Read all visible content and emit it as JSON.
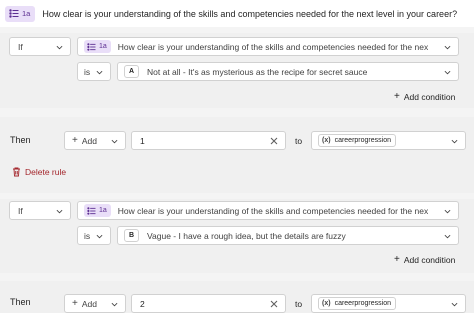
{
  "header": {
    "question_id": "1a",
    "question_icon": "choice-list-icon",
    "title": "How clear is your understanding of the skills and competencies needed for the next level in your career?"
  },
  "rules": [
    {
      "condition_type": "If",
      "question_id": "1a",
      "question_text": "How clear is your understanding of the skills and competencies needed for the next l...",
      "operator": "is",
      "answer_letter": "A",
      "answer_text": "Not at all - It's as mysterious as the recipe for secret sauce",
      "add_condition_label": "Add condition",
      "then_label": "Then",
      "action_label": "Add",
      "action_value": "1",
      "to_label": "to",
      "variable_icon": "(x)",
      "variable_name": "careerprogression",
      "delete_label": "Delete rule"
    },
    {
      "condition_type": "If",
      "question_id": "1a",
      "question_text": "How clear is your understanding of the skills and competencies needed for the next l...",
      "operator": "is",
      "answer_letter": "B",
      "answer_text": "Vague - I have a rough idea, but the details are fuzzy",
      "add_condition_label": "Add condition",
      "then_label": "Then",
      "action_label": "Add",
      "action_value": "2",
      "to_label": "to",
      "variable_icon": "(x)",
      "variable_name": "careerprogression"
    }
  ],
  "colors": {
    "badge_bg": "#e9def8",
    "badge_text": "#5c2e91",
    "delete": "#a4262c",
    "panel_bg": "#f0f0f0",
    "separator": "#ffffff"
  }
}
